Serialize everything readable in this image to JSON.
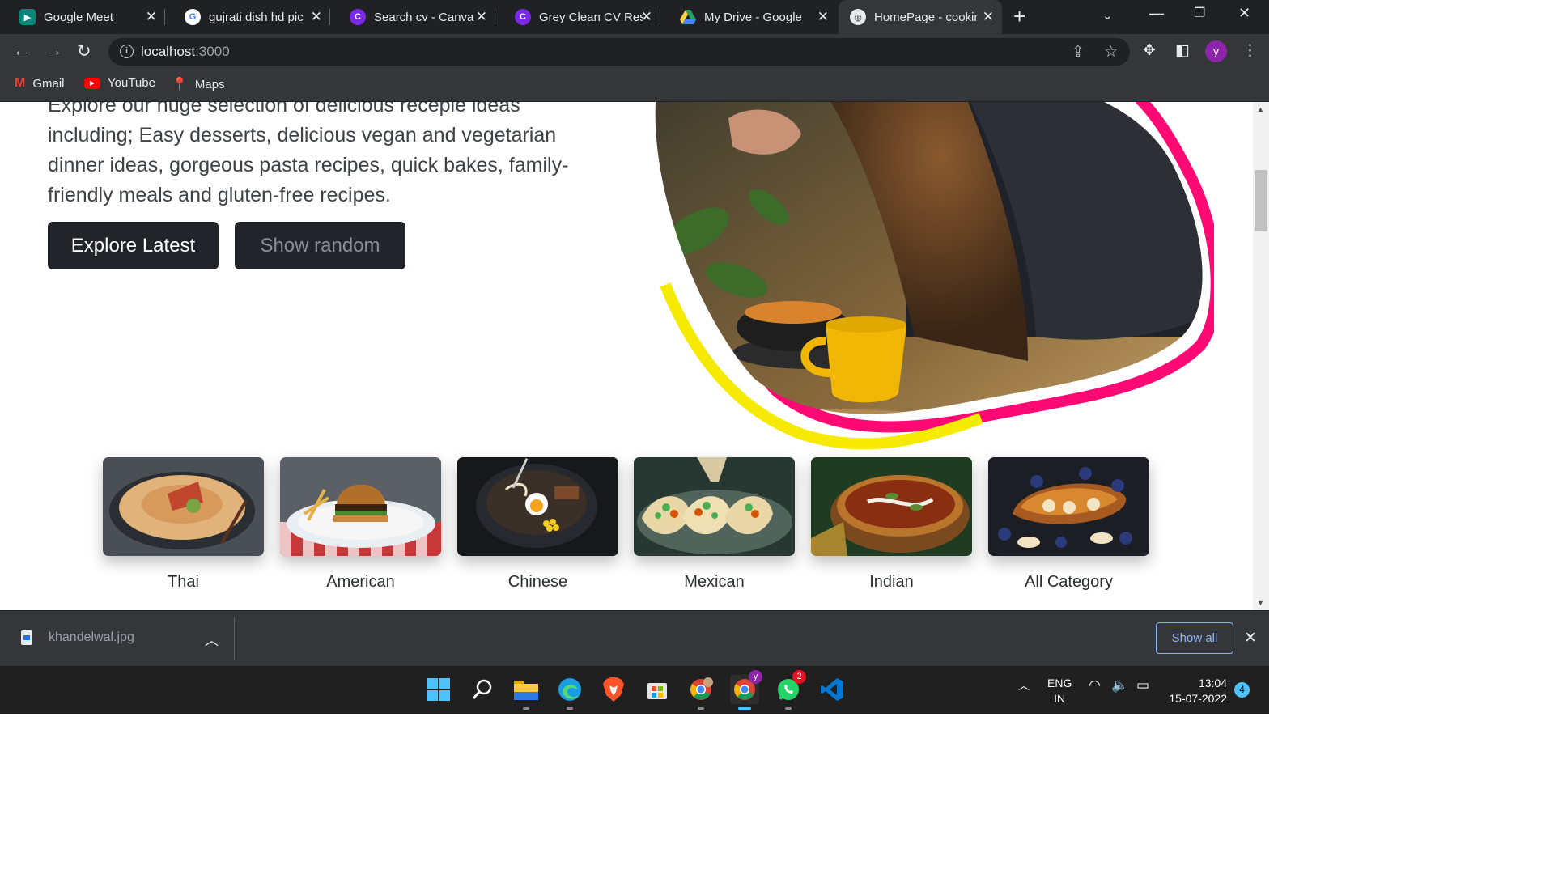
{
  "browser": {
    "tabs": [
      {
        "title": "Google Meet",
        "icon": "google-meet-icon",
        "color": "#00897b"
      },
      {
        "title": "gujrati dish hd pic",
        "icon": "google-icon",
        "color": "#4285f4"
      },
      {
        "title": "Search cv - Canva",
        "icon": "canva-icon",
        "color": "#7d2ae8"
      },
      {
        "title": "Grey Clean CV Resu",
        "icon": "canva-icon",
        "color": "#7d2ae8"
      },
      {
        "title": "My Drive - Google",
        "icon": "google-drive-icon",
        "color": "#1fa463"
      },
      {
        "title": "HomePage - cookin",
        "icon": "globe-icon",
        "color": "#9aa0a6"
      }
    ],
    "url_host": "localhost",
    "url_port": ":3000",
    "profile_initial": "y",
    "bookmarks": [
      {
        "label": "Gmail",
        "icon": "gmail-icon"
      },
      {
        "label": "YouTube",
        "icon": "youtube-icon"
      },
      {
        "label": "Maps",
        "icon": "maps-icon"
      }
    ]
  },
  "hero": {
    "intro_text": "Explore our huge selection of delicious recepie ideas including; Easy desserts, delicious vegan and vegetarian dinner ideas, gorgeous pasta recipes, quick bakes, family-friendly meals and gluten-free recipes.",
    "explore_button": "Explore Latest",
    "random_button": "Show random"
  },
  "categories": [
    {
      "label": "Thai"
    },
    {
      "label": "American"
    },
    {
      "label": "Chinese"
    },
    {
      "label": "Mexican"
    },
    {
      "label": "Indian"
    },
    {
      "label": "All Category"
    }
  ],
  "downloads": {
    "file_name": "khandelwal.jpg",
    "show_all": "Show all"
  },
  "taskbar": {
    "lang_line1": "ENG",
    "lang_line2": "IN",
    "time": "13:04",
    "date": "15-07-2022",
    "notifications": "4",
    "whatsapp_badge": "2",
    "chrome_profile_badge": "y"
  }
}
